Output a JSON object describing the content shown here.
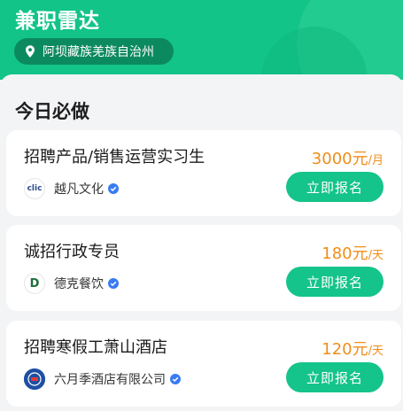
{
  "app": {
    "title": "兼职雷达"
  },
  "location": {
    "label": "阿坝藏族羌族自治州"
  },
  "section": {
    "title": "今日必做"
  },
  "jobs": [
    {
      "title": "招聘产品/销售运营实习生",
      "salary": "3000元",
      "unit": "/月",
      "company": "越凡文化",
      "logo_text": "clic",
      "apply_label": "立即报名"
    },
    {
      "title": "诚招行政专员",
      "salary": "180元",
      "unit": "/天",
      "company": "德克餐饮",
      "logo_text": "D",
      "apply_label": "立即报名"
    },
    {
      "title": "招聘寒假工萧山酒店",
      "salary": "120元",
      "unit": "/天",
      "company": "六月季酒店有限公司",
      "logo_text": "",
      "apply_label": "立即报名"
    }
  ],
  "colors": {
    "brand_green": "#14c48a",
    "salary_orange": "#f08d1a",
    "verified_blue": "#3a7bf2"
  },
  "icons": {
    "location": "location-pin-icon",
    "verified": "verified-badge-icon"
  }
}
